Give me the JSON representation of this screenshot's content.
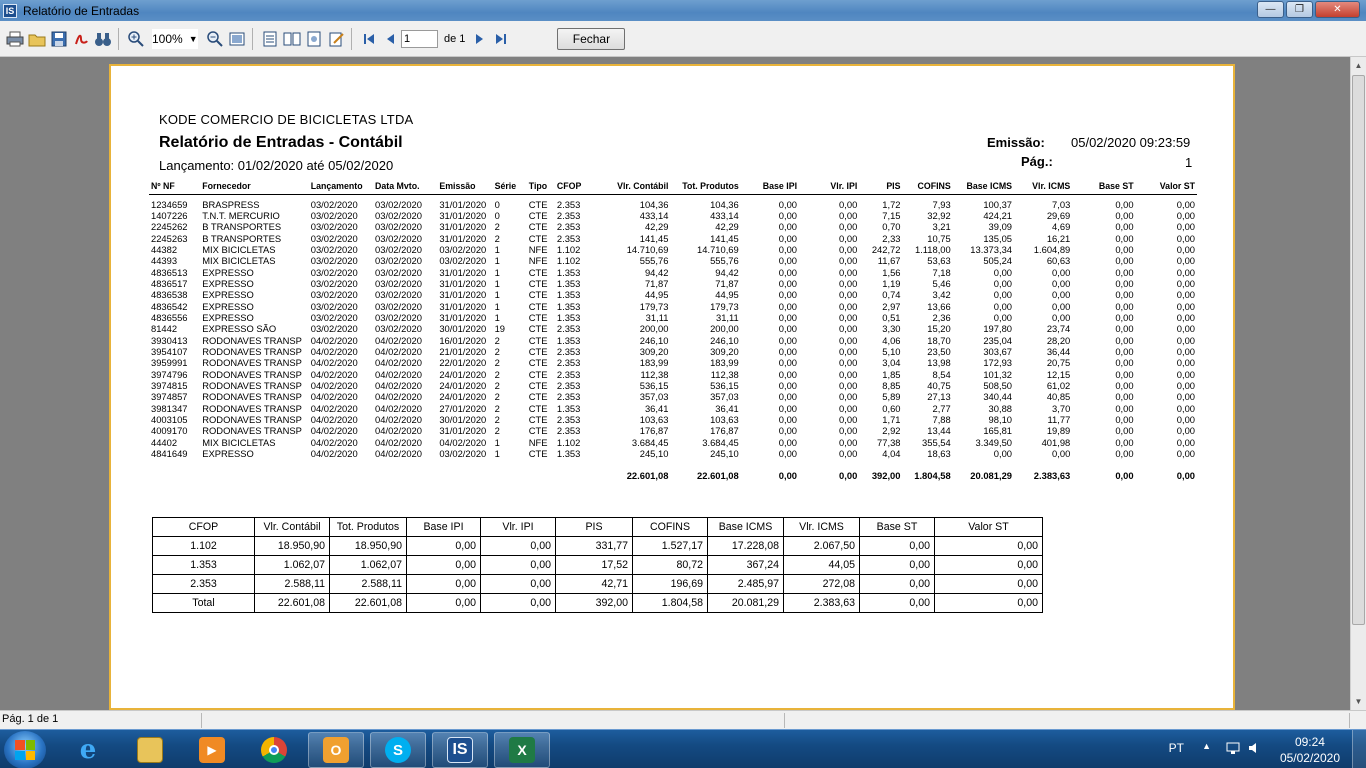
{
  "window": {
    "title": "Relatório de Entradas",
    "app_icon": "IS",
    "minimize": "—",
    "maximize": "❐",
    "close": "✕"
  },
  "toolbar": {
    "zoom": "100%",
    "page_value": "1",
    "page_of": "de 1",
    "fechar": "Fechar"
  },
  "report": {
    "company": "KODE COMERCIO DE BICICLETAS LTDA",
    "title": "Relatório de Entradas - Contábil",
    "period": "Lançamento: 01/02/2020 até 05/02/2020",
    "emissao_label": "Emissão:",
    "emissao_value": "05/02/2020 09:23:59",
    "pag_label": "Pág.:",
    "pag_value": "1",
    "columns": [
      "Nº NF",
      "Fornecedor",
      "Lançamento",
      "Data Mvto.",
      "Emissão",
      "Série",
      "Tipo",
      "CFOP",
      "Vlr. Contábil",
      "Tot. Produtos",
      "Base IPI",
      "Vlr. IPI",
      "PIS",
      "COFINS",
      "Base ICMS",
      "Vlr. ICMS",
      "Base ST",
      "Valor ST"
    ],
    "rows": [
      [
        "1234659",
        "BRASPRESS",
        "03/02/2020",
        "03/02/2020",
        "31/01/2020",
        "0",
        "CTE",
        "2.353",
        "104,36",
        "104,36",
        "0,00",
        "0,00",
        "1,72",
        "7,93",
        "100,37",
        "7,03",
        "0,00",
        "0,00"
      ],
      [
        "1407226",
        "T.N.T. MERCURIO",
        "03/02/2020",
        "03/02/2020",
        "31/01/2020",
        "0",
        "CTE",
        "2.353",
        "433,14",
        "433,14",
        "0,00",
        "0,00",
        "7,15",
        "32,92",
        "424,21",
        "29,69",
        "0,00",
        "0,00"
      ],
      [
        "2245262",
        "B TRANSPORTES",
        "03/02/2020",
        "03/02/2020",
        "31/01/2020",
        "2",
        "CTE",
        "2.353",
        "42,29",
        "42,29",
        "0,00",
        "0,00",
        "0,70",
        "3,21",
        "39,09",
        "4,69",
        "0,00",
        "0,00"
      ],
      [
        "2245263",
        "B TRANSPORTES",
        "03/02/2020",
        "03/02/2020",
        "31/01/2020",
        "2",
        "CTE",
        "2.353",
        "141,45",
        "141,45",
        "0,00",
        "0,00",
        "2,33",
        "10,75",
        "135,05",
        "16,21",
        "0,00",
        "0,00"
      ],
      [
        "44382",
        "MIX BICICLETAS",
        "03/02/2020",
        "03/02/2020",
        "03/02/2020",
        "1",
        "NFE",
        "1.102",
        "14.710,69",
        "14.710,69",
        "0,00",
        "0,00",
        "242,72",
        "1.118,00",
        "13.373,34",
        "1.604,89",
        "0,00",
        "0,00"
      ],
      [
        "44393",
        "MIX BICICLETAS",
        "03/02/2020",
        "03/02/2020",
        "03/02/2020",
        "1",
        "NFE",
        "1.102",
        "555,76",
        "555,76",
        "0,00",
        "0,00",
        "11,67",
        "53,63",
        "505,24",
        "60,63",
        "0,00",
        "0,00"
      ],
      [
        "4836513",
        "EXPRESSO",
        "03/02/2020",
        "03/02/2020",
        "31/01/2020",
        "1",
        "CTE",
        "1.353",
        "94,42",
        "94,42",
        "0,00",
        "0,00",
        "1,56",
        "7,18",
        "0,00",
        "0,00",
        "0,00",
        "0,00"
      ],
      [
        "4836517",
        "EXPRESSO",
        "03/02/2020",
        "03/02/2020",
        "31/01/2020",
        "1",
        "CTE",
        "1.353",
        "71,87",
        "71,87",
        "0,00",
        "0,00",
        "1,19",
        "5,46",
        "0,00",
        "0,00",
        "0,00",
        "0,00"
      ],
      [
        "4836538",
        "EXPRESSO",
        "03/02/2020",
        "03/02/2020",
        "31/01/2020",
        "1",
        "CTE",
        "1.353",
        "44,95",
        "44,95",
        "0,00",
        "0,00",
        "0,74",
        "3,42",
        "0,00",
        "0,00",
        "0,00",
        "0,00"
      ],
      [
        "4836542",
        "EXPRESSO",
        "03/02/2020",
        "03/02/2020",
        "31/01/2020",
        "1",
        "CTE",
        "1.353",
        "179,73",
        "179,73",
        "0,00",
        "0,00",
        "2,97",
        "13,66",
        "0,00",
        "0,00",
        "0,00",
        "0,00"
      ],
      [
        "4836556",
        "EXPRESSO",
        "03/02/2020",
        "03/02/2020",
        "31/01/2020",
        "1",
        "CTE",
        "1.353",
        "31,11",
        "31,11",
        "0,00",
        "0,00",
        "0,51",
        "2,36",
        "0,00",
        "0,00",
        "0,00",
        "0,00"
      ],
      [
        "81442",
        "EXPRESSO SÃO",
        "03/02/2020",
        "03/02/2020",
        "30/01/2020",
        "19",
        "CTE",
        "2.353",
        "200,00",
        "200,00",
        "0,00",
        "0,00",
        "3,30",
        "15,20",
        "197,80",
        "23,74",
        "0,00",
        "0,00"
      ],
      [
        "3930413",
        "RODONAVES TRANSP",
        "04/02/2020",
        "04/02/2020",
        "16/01/2020",
        "2",
        "CTE",
        "1.353",
        "246,10",
        "246,10",
        "0,00",
        "0,00",
        "4,06",
        "18,70",
        "235,04",
        "28,20",
        "0,00",
        "0,00"
      ],
      [
        "3954107",
        "RODONAVES TRANSP",
        "04/02/2020",
        "04/02/2020",
        "21/01/2020",
        "2",
        "CTE",
        "2.353",
        "309,20",
        "309,20",
        "0,00",
        "0,00",
        "5,10",
        "23,50",
        "303,67",
        "36,44",
        "0,00",
        "0,00"
      ],
      [
        "3959991",
        "RODONAVES TRANSP",
        "04/02/2020",
        "04/02/2020",
        "22/01/2020",
        "2",
        "CTE",
        "2.353",
        "183,99",
        "183,99",
        "0,00",
        "0,00",
        "3,04",
        "13,98",
        "172,93",
        "20,75",
        "0,00",
        "0,00"
      ],
      [
        "3974796",
        "RODONAVES TRANSP",
        "04/02/2020",
        "04/02/2020",
        "24/01/2020",
        "2",
        "CTE",
        "2.353",
        "112,38",
        "112,38",
        "0,00",
        "0,00",
        "1,85",
        "8,54",
        "101,32",
        "12,15",
        "0,00",
        "0,00"
      ],
      [
        "3974815",
        "RODONAVES TRANSP",
        "04/02/2020",
        "04/02/2020",
        "24/01/2020",
        "2",
        "CTE",
        "2.353",
        "536,15",
        "536,15",
        "0,00",
        "0,00",
        "8,85",
        "40,75",
        "508,50",
        "61,02",
        "0,00",
        "0,00"
      ],
      [
        "3974857",
        "RODONAVES TRANSP",
        "04/02/2020",
        "04/02/2020",
        "24/01/2020",
        "2",
        "CTE",
        "2.353",
        "357,03",
        "357,03",
        "0,00",
        "0,00",
        "5,89",
        "27,13",
        "340,44",
        "40,85",
        "0,00",
        "0,00"
      ],
      [
        "3981347",
        "RODONAVES TRANSP",
        "04/02/2020",
        "04/02/2020",
        "27/01/2020",
        "2",
        "CTE",
        "1.353",
        "36,41",
        "36,41",
        "0,00",
        "0,00",
        "0,60",
        "2,77",
        "30,88",
        "3,70",
        "0,00",
        "0,00"
      ],
      [
        "4003105",
        "RODONAVES TRANSP",
        "04/02/2020",
        "04/02/2020",
        "30/01/2020",
        "2",
        "CTE",
        "2.353",
        "103,63",
        "103,63",
        "0,00",
        "0,00",
        "1,71",
        "7,88",
        "98,10",
        "11,77",
        "0,00",
        "0,00"
      ],
      [
        "4009170",
        "RODONAVES TRANSP",
        "04/02/2020",
        "04/02/2020",
        "31/01/2020",
        "2",
        "CTE",
        "2.353",
        "176,87",
        "176,87",
        "0,00",
        "0,00",
        "2,92",
        "13,44",
        "165,81",
        "19,89",
        "0,00",
        "0,00"
      ],
      [
        "44402",
        "MIX BICICLETAS",
        "04/02/2020",
        "04/02/2020",
        "04/02/2020",
        "1",
        "NFE",
        "1.102",
        "3.684,45",
        "3.684,45",
        "0,00",
        "0,00",
        "77,38",
        "355,54",
        "3.349,50",
        "401,98",
        "0,00",
        "0,00"
      ],
      [
        "4841649",
        "EXPRESSO",
        "04/02/2020",
        "04/02/2020",
        "03/02/2020",
        "1",
        "CTE",
        "1.353",
        "245,10",
        "245,10",
        "0,00",
        "0,00",
        "4,04",
        "18,63",
        "0,00",
        "0,00",
        "0,00",
        "0,00"
      ]
    ],
    "totals": [
      "22.601,08",
      "22.601,08",
      "0,00",
      "0,00",
      "392,00",
      "1.804,58",
      "20.081,29",
      "2.383,63",
      "0,00",
      "0,00"
    ],
    "summary_columns": [
      "CFOP",
      "Vlr. Contábil",
      "Tot. Produtos",
      "Base IPI",
      "Vlr. IPI",
      "PIS",
      "COFINS",
      "Base ICMS",
      "Vlr. ICMS",
      "Base ST",
      "Valor ST"
    ],
    "summary_rows": [
      [
        "1.102",
        "18.950,90",
        "18.950,90",
        "0,00",
        "0,00",
        "331,77",
        "1.527,17",
        "17.228,08",
        "2.067,50",
        "0,00",
        "0,00"
      ],
      [
        "1.353",
        "1.062,07",
        "1.062,07",
        "0,00",
        "0,00",
        "17,52",
        "80,72",
        "367,24",
        "44,05",
        "0,00",
        "0,00"
      ],
      [
        "2.353",
        "2.588,11",
        "2.588,11",
        "0,00",
        "0,00",
        "42,71",
        "196,69",
        "2.485,97",
        "272,08",
        "0,00",
        "0,00"
      ],
      [
        "Total",
        "22.601,08",
        "22.601,08",
        "0,00",
        "0,00",
        "392,00",
        "1.804,58",
        "20.081,29",
        "2.383,63",
        "0,00",
        "0,00"
      ]
    ]
  },
  "statusbar": {
    "page": "Pág. 1 de 1"
  },
  "taskbar": {
    "lang": "PT",
    "time": "09:24",
    "date": "05/02/2020"
  }
}
